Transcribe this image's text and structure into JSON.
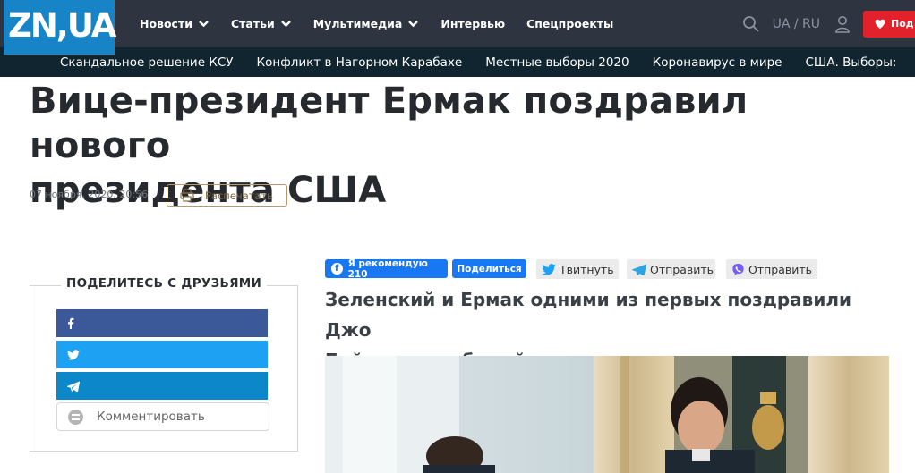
{
  "site": {
    "logo": "ZN,UA",
    "nav": [
      "Новости",
      "Статьи",
      "Мультимедиа",
      "Интервью",
      "Спецпроекты"
    ],
    "lang": "UA / RU",
    "support_label": "Под"
  },
  "subnav": [
    "Скандальное решение КСУ",
    "Конфликт в Нагорном Карабахе",
    "Местные выборы 2020",
    "Коронавирус в мире",
    "США. Выборы: Трамп"
  ],
  "article": {
    "title_line1": "Вице-президент Ермак поздравил нового",
    "title_line2": "президента США",
    "date": "07 ноября, 2020, 20:56",
    "print_label": "Распечатать",
    "lead_line1": "Зеленский и Ермак одними из первых поздравили Джо",
    "lead_line2": "Байдена с победой."
  },
  "share": {
    "title": "ПОДЕЛИТЕСЬ С ДРУЗЬЯМИ",
    "comment_label": "Комментировать"
  },
  "social": {
    "fb_like": "Я рекомендую 210",
    "fb_share": "Поделиться",
    "twitter": "Твитнуть",
    "telegram": "Отправить",
    "viber": "Отправить"
  },
  "colors": {
    "topbar": "#2e3440",
    "subbar": "#10252f",
    "logo": "#1784c7",
    "support": "#e2222b",
    "facebook": "#3b5998",
    "twitter": "#1da1f2",
    "telegram": "#0c87c9",
    "fb_blue": "#1877f2",
    "print_border": "#b8976a"
  },
  "icons": {
    "search": "search-icon",
    "user": "user-icon",
    "chevron": "chevron-down-icon",
    "print": "print-icon",
    "facebook": "facebook-icon",
    "twitter": "twitter-icon",
    "telegram": "telegram-icon",
    "viber": "viber-icon",
    "comment": "comment-icon",
    "heart": "heart-icon"
  }
}
